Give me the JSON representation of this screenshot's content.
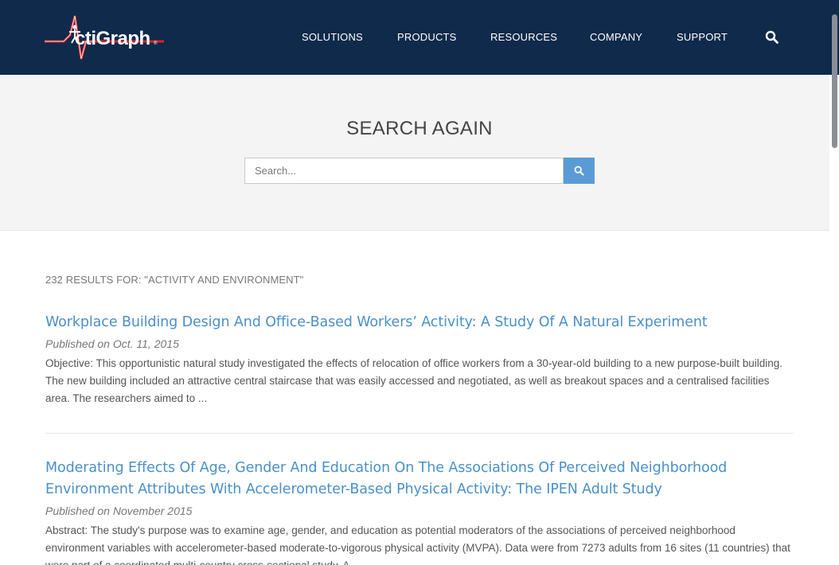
{
  "header": {
    "logo_text": "ctiGraph",
    "logo_mark": "A",
    "logo_registered": "®",
    "nav": [
      {
        "label": "SOLUTIONS"
      },
      {
        "label": "PRODUCTS"
      },
      {
        "label": "RESOURCES"
      },
      {
        "label": "COMPANY"
      },
      {
        "label": "SUPPORT"
      }
    ],
    "search_icon": "search-icon"
  },
  "search": {
    "title": "SEARCH AGAIN",
    "placeholder": "Search...",
    "value": "",
    "button_icon": "search-icon"
  },
  "results": {
    "summary": "232 RESULTS FOR: \"ACTIVITY AND ENVIRONMENT\"",
    "items": [
      {
        "title": "Workplace Building Design And Office-Based Workers’ Activity: A Study Of A Natural Experiment",
        "date": "Published on Oct. 11, 2015",
        "excerpt": "Objective: This opportunistic natural study investigated the effects of relocation of office workers from a 30-year-old building to a new purpose-built building. The new building included an attractive central staircase that was easily accessed and negotiated, as well as breakout spaces and a centralised facilities area. The researchers aimed to ..."
      },
      {
        "title": "Moderating Effects Of Age, Gender And Education On The Associations Of Perceived Neighborhood Environment Attributes With Accelerometer-Based Physical Activity: The IPEN Adult Study",
        "date": "Published on November 2015",
        "excerpt": "Abstract: The study's purpose was to examine age, gender, and education as potential moderators of the associations of perceived neighborhood environment variables with accelerometer-based moderate-to-vigorous physical activity (MVPA). Data were from 7273 adults from 16 sites (11 countries) that were part of a coordinated multi-country cross-sectional study. A..."
      }
    ]
  },
  "colors": {
    "header_bg": "#0f2a4a",
    "accent": "#5b9bd5",
    "link": "#4a90c8",
    "logo_red": "#d6232a"
  }
}
